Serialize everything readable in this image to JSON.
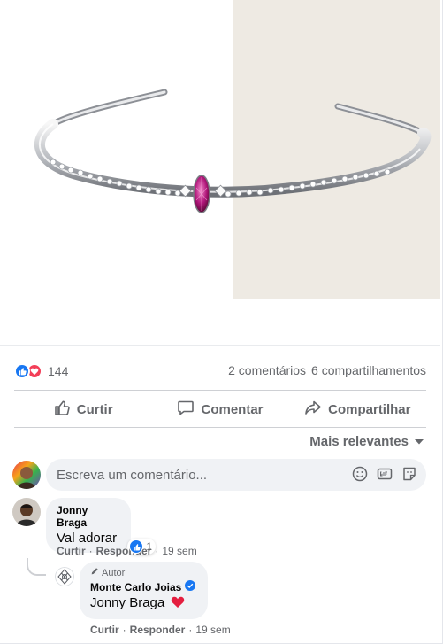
{
  "post": {
    "image_alt": "silver cuff bracelet with pink marquise stone",
    "colors": {
      "brand_blue": "#1877f2",
      "love_red": "#f33e58",
      "secondary_text": "#65676b",
      "bubble_bg": "#f0f2f5"
    }
  },
  "reactions": {
    "count": "144",
    "icons": [
      "like-icon",
      "love-icon"
    ]
  },
  "stats": {
    "comments": "2 comentários",
    "shares": "6 compartilhamentos"
  },
  "actions": {
    "like": "Curtir",
    "comment": "Comentar",
    "share": "Compartilhar"
  },
  "sort": {
    "label": "Mais relevantes"
  },
  "composer": {
    "placeholder": "Escreva um comentário..."
  },
  "comments": [
    {
      "author": "Jonny Braga",
      "text": "Val adorar",
      "reaction_count": "1",
      "actions": {
        "like": "Curtir",
        "reply": "Responder",
        "time": "19 sem"
      }
    }
  ],
  "reply": {
    "tag": "Autor",
    "author": "Monte Carlo Joias",
    "text": "Jonny Braga",
    "actions": {
      "like": "Curtir",
      "reply": "Responder",
      "time": "19 sem"
    }
  },
  "separator": "·"
}
